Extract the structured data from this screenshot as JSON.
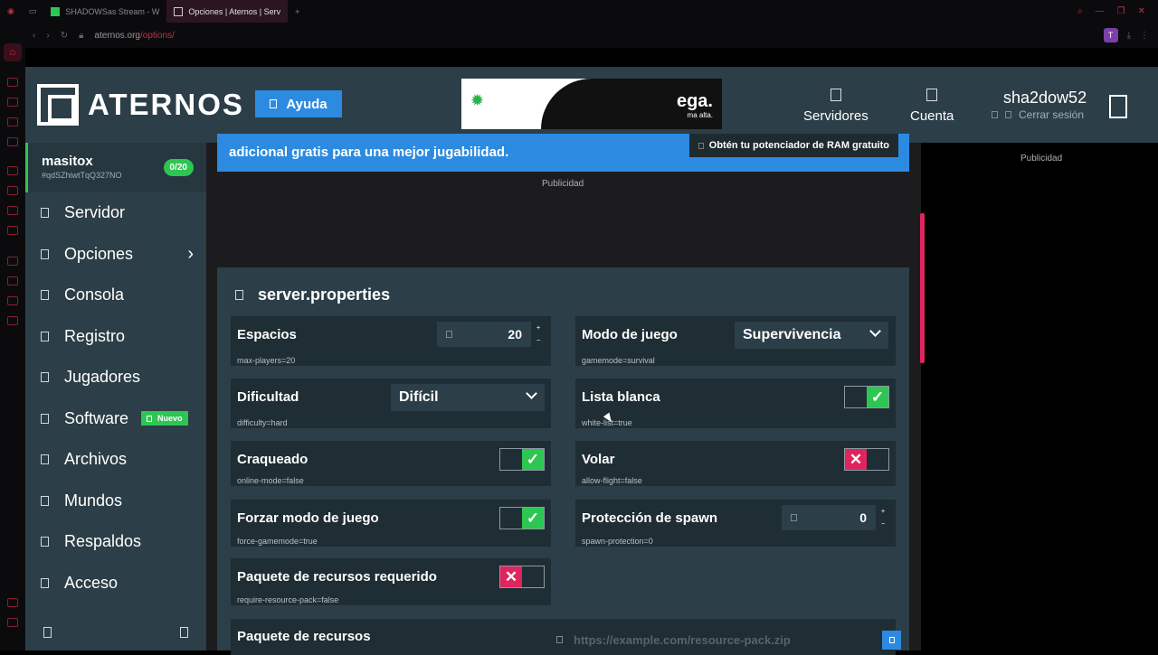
{
  "browser": {
    "tabs": [
      {
        "label": "SHADOWSas Stream - W"
      },
      {
        "label": "Opciones | Aternos | Serv"
      }
    ],
    "url_host": "aternos.org",
    "url_path": "/options/",
    "profile_initial": "T"
  },
  "header": {
    "logo_text": "ATERNOS",
    "help_label": "Ayuda",
    "ad_text": "ega.",
    "ad_sub": "ma alta.",
    "nav": [
      {
        "label": "Servidores"
      },
      {
        "label": "Cuenta"
      }
    ],
    "username": "sha2dow52",
    "logout_label": "Cerrar sesión"
  },
  "sidebar": {
    "server_name": "masitox",
    "server_id": "#qdSZhiwtTqQ327NO",
    "players_badge": "0/20",
    "items": [
      {
        "label": "Servidor"
      },
      {
        "label": "Opciones"
      },
      {
        "label": "Consola"
      },
      {
        "label": "Registro"
      },
      {
        "label": "Jugadores"
      },
      {
        "label": "Software",
        "badge": "Nuevo"
      },
      {
        "label": "Archivos"
      },
      {
        "label": "Mundos"
      },
      {
        "label": "Respaldos"
      },
      {
        "label": "Acceso"
      }
    ]
  },
  "main": {
    "banner_text": "adicional gratis para una mejor jugabilidad.",
    "banner_button": "Obtén tu potenciador de RAM gratuito",
    "ad_label": "Publicidad",
    "right_ad_label": "Publicidad",
    "panel_title": "server.properties",
    "options": {
      "espacios": {
        "label": "Espacios",
        "value": "20",
        "key": "max-players=20"
      },
      "modo": {
        "label": "Modo de juego",
        "value": "Supervivencia",
        "key": "gamemode=survival"
      },
      "dificultad": {
        "label": "Dificultad",
        "value": "Difícil",
        "key": "difficulty=hard"
      },
      "lista": {
        "label": "Lista blanca",
        "state": "on",
        "key": "white-list=true"
      },
      "craqueado": {
        "label": "Craqueado",
        "state": "on",
        "key": "online-mode=false"
      },
      "volar": {
        "label": "Volar",
        "state": "off",
        "key": "allow-flight=false"
      },
      "forzar": {
        "label": "Forzar modo de juego",
        "state": "on",
        "key": "force-gamemode=true"
      },
      "proteccion": {
        "label": "Protección de spawn",
        "value": "0",
        "key": "spawn-protection=0"
      },
      "paquete_req": {
        "label": "Paquete de recursos requerido",
        "state": "off",
        "key": "require-resource-pack=false"
      },
      "paquete": {
        "label": "Paquete de recursos",
        "placeholder": "https://example.com/resource-pack.zip"
      }
    }
  },
  "icons": {
    "check": "✓",
    "cross": "✕",
    "chevron": "›"
  },
  "colors": {
    "accent_blue": "#2c8be0",
    "green": "#2dc653",
    "red": "#e0245e",
    "panel": "#2c3e47"
  }
}
